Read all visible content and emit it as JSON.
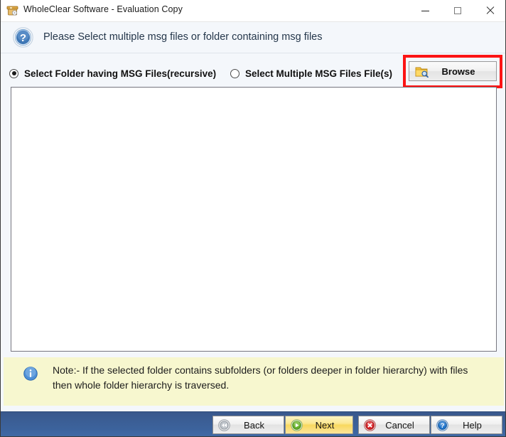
{
  "window": {
    "title": "WholeClear Software - Evaluation Copy",
    "app_icon": "archive-box-icon",
    "controls": {
      "minimize": "minimize-icon",
      "maximize": "maximize-icon",
      "close": "close-icon"
    }
  },
  "header": {
    "icon": "question-mark-circle-icon",
    "instruction": "Please Select multiple msg files or folder containing msg files"
  },
  "options": {
    "radio_folder": {
      "label": "Select Folder having MSG Files(recursive)",
      "selected": true
    },
    "radio_files": {
      "label": "Select Multiple MSG Files File(s)",
      "selected": false
    },
    "browse": {
      "label": "Browse",
      "icon": "folder-search-icon",
      "highlight_color": "#fc1414"
    }
  },
  "list_area": {
    "items": [],
    "empty_text": ""
  },
  "note": {
    "icon": "info-circle-icon",
    "text": "Note:- If the selected folder contains subfolders (or folders deeper in folder hierarchy) with files then whole folder hierarchy is traversed."
  },
  "footer": {
    "buttons": [
      {
        "label": "Back",
        "icon": "rewind-circle-icon",
        "accent": "#8d9299"
      },
      {
        "label": "Next",
        "icon": "play-circle-icon",
        "accent": "#5aa72a"
      },
      {
        "label": "Cancel",
        "icon": "close-circle-icon",
        "accent": "#d61f23"
      },
      {
        "label": "Help",
        "icon": "question-circle-icon",
        "accent": "#1f72c8"
      }
    ],
    "bar_color": "#3c639d"
  }
}
